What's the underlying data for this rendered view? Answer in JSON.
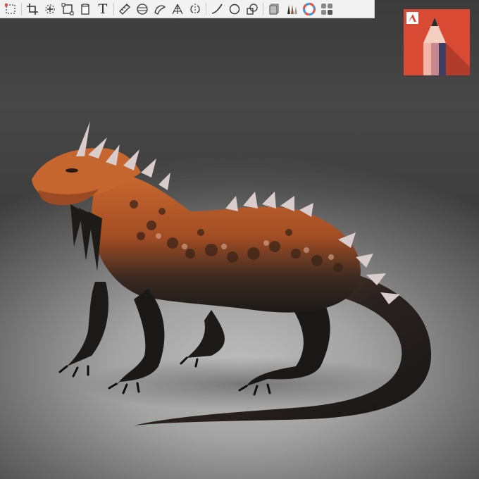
{
  "toolbar": {
    "tools": [
      {
        "name": "selection-tool",
        "icon": "dotted-square-icon"
      },
      {
        "name": "crop-tool",
        "icon": "crop-icon"
      },
      {
        "name": "transform-tool",
        "icon": "move-transform-icon"
      },
      {
        "name": "distort-tool",
        "icon": "distort-square-icon"
      },
      {
        "name": "fill-tool",
        "icon": "paint-bucket-icon"
      },
      {
        "name": "text-tool",
        "icon": "text-icon",
        "glyph": "T"
      },
      {
        "name": "ruler-tool",
        "icon": "ruler-icon"
      },
      {
        "name": "ellipse-guide-tool",
        "icon": "ellipse-guide-icon"
      },
      {
        "name": "french-curve-tool",
        "icon": "french-curve-icon"
      },
      {
        "name": "perspective-tool",
        "icon": "perspective-grid-icon"
      },
      {
        "name": "symmetry-tool",
        "icon": "symmetry-icon"
      },
      {
        "name": "line-tool",
        "icon": "curve-line-icon"
      },
      {
        "name": "circle-tool",
        "icon": "circle-icon"
      },
      {
        "name": "shape-tool",
        "icon": "shapes-icon"
      },
      {
        "name": "layers-tool",
        "icon": "layers-icon"
      },
      {
        "name": "brushes-tool",
        "icon": "brushes-icon"
      },
      {
        "name": "color-wheel-tool",
        "icon": "color-wheel-icon"
      },
      {
        "name": "color-puck-tool",
        "icon": "color-grid-icon"
      }
    ]
  },
  "logo": {
    "name": "autodesk-sketchbook-logo",
    "brand_letter": "A",
    "colors": {
      "background": "#d94a35",
      "pencil_light": "#f2b6a9",
      "pencil_mid": "#c7878d",
      "pencil_dark": "#3f3f63"
    }
  },
  "artwork": {
    "subject": "orange-dragon-lizard-illustration",
    "colors": {
      "body_orange": "#c5622d",
      "body_dark": "#1f1c1a",
      "spikes": "#d9cfcf"
    }
  }
}
